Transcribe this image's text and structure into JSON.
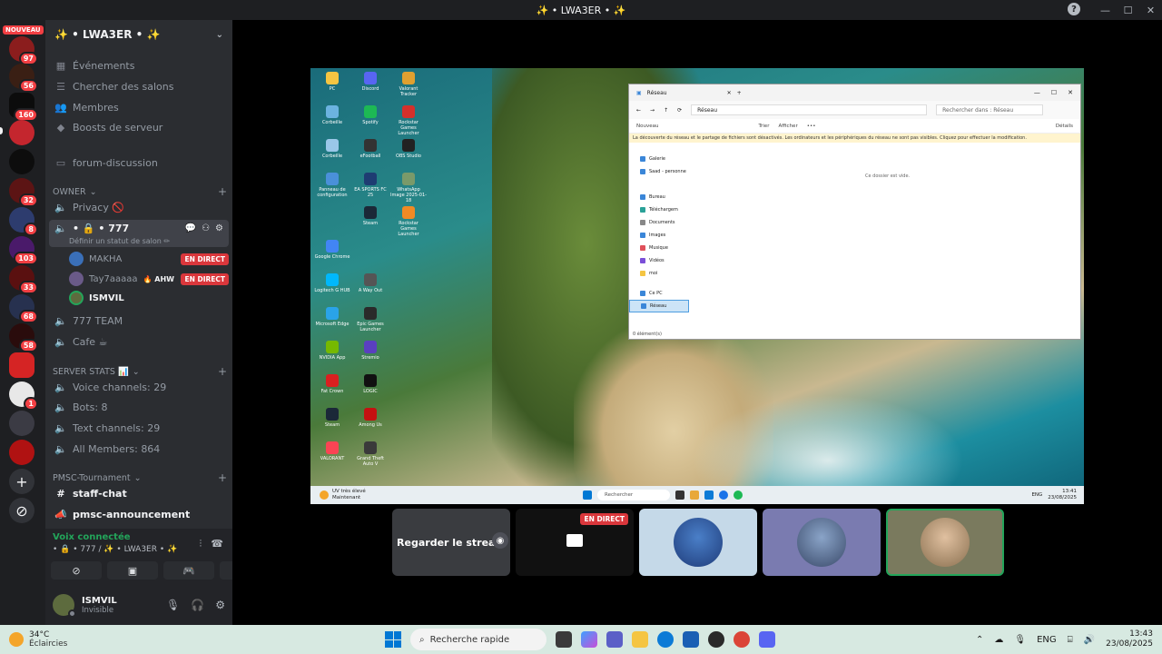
{
  "window": {
    "title": "✨ • LWA3ER • ✨",
    "help": "?",
    "minimize": "—",
    "maximize": "☐",
    "close": "✕"
  },
  "rail": {
    "nouveau": "NOUVEAU",
    "badges": [
      "97",
      "56",
      "160",
      "32",
      "8",
      "103",
      "33",
      "68",
      "58",
      "1"
    ]
  },
  "guild": {
    "name": "✨ • LWA3ER • ✨",
    "channels_top": [
      "Événements",
      "Chercher des salons",
      "Membres",
      "Boosts de serveur"
    ],
    "forum": "forum-discussion",
    "cat_owner": "OWNER",
    "privacy": "Privacy 🚫",
    "voice_777": "• 🔒 • 777",
    "status_hint": "Définir un statut de salon ✏",
    "voice_users": [
      {
        "name": "MAKHA",
        "live": "EN DIRECT"
      },
      {
        "name": "Tay7aaaaa",
        "tag": "🔥 AHW",
        "live": "EN DIRECT"
      },
      {
        "name": "ISMVIL",
        "live": ""
      }
    ],
    "team": "777 TEAM",
    "cafe": "Cafe ☕",
    "cat_stats": "SERVER STATS 📊",
    "stats": [
      "Voice channels: 29",
      "Bots: 8",
      "Text channels: 29",
      "All Members: 864"
    ],
    "cat_pmsc": "PMSC-Tournament",
    "pmsc": [
      "staff-chat",
      "pmsc-announcement"
    ]
  },
  "voice": {
    "connected": "Voix connectée",
    "location": "• 🔒 • 777 / ✨ • LWA3ER • ✨"
  },
  "user": {
    "name": "ISMVIL",
    "status": "Invisible"
  },
  "stream": {
    "explorer": {
      "tab": "Réseau",
      "path": "Réseau",
      "search": "Rechercher dans : Réseau",
      "tools": [
        "Nouveau",
        "Trier",
        "Afficher",
        "•••"
      ],
      "details": "Détails",
      "warning": "La découverte du réseau et le partage de fichiers sont désactivés. Les ordinateurs et les périphériques du réseau ne sont pas visibles. Cliquez pour effectuer la modification.",
      "nav": [
        "Galerie",
        "Saad - personne",
        "Bureau",
        "Téléchargem",
        "Documents",
        "Images",
        "Musique",
        "Vidéos",
        "moi",
        "Ce PC",
        "Réseau"
      ],
      "empty": "Ce dossier est vide.",
      "status": "0 élément(s)"
    },
    "desktop_icons": [
      "PC",
      "Discord",
      "Valorant Tracker",
      "Corbeille",
      "Spotify",
      "Rockstar Games Launcher",
      "Corbeille",
      "eFootball",
      "OBS Studio",
      "Panneau de configuration",
      "EA SPORTS FC 25",
      "WhatsApp Image 2025-01-18",
      "Google Chrome",
      "Steam",
      "Rockstar Games Launcher",
      "Logitech G HUB",
      "A Way Out",
      "Microsoft Edge",
      "Epic Games Launcher",
      "NVIDIA App",
      "Stremio",
      "Fat Crown",
      "LOGIC",
      "Steam",
      "Among Us",
      "VALORANT",
      "Grand Theft Auto V"
    ],
    "taskbar": {
      "weather1": "UV très élevé",
      "weather2": "Maintenant",
      "search": "Rechercher",
      "lang": "ENG",
      "time": "13:41",
      "date": "23/08/2025"
    }
  },
  "tiles": {
    "watch": "Regarder le stream",
    "live": "EN DIRECT"
  },
  "taskbar": {
    "temp": "34°C",
    "weather": "Éclaircies",
    "search": "Recherche rapide",
    "lang": "ENG",
    "time": "13:43",
    "date": "23/08/2025"
  }
}
